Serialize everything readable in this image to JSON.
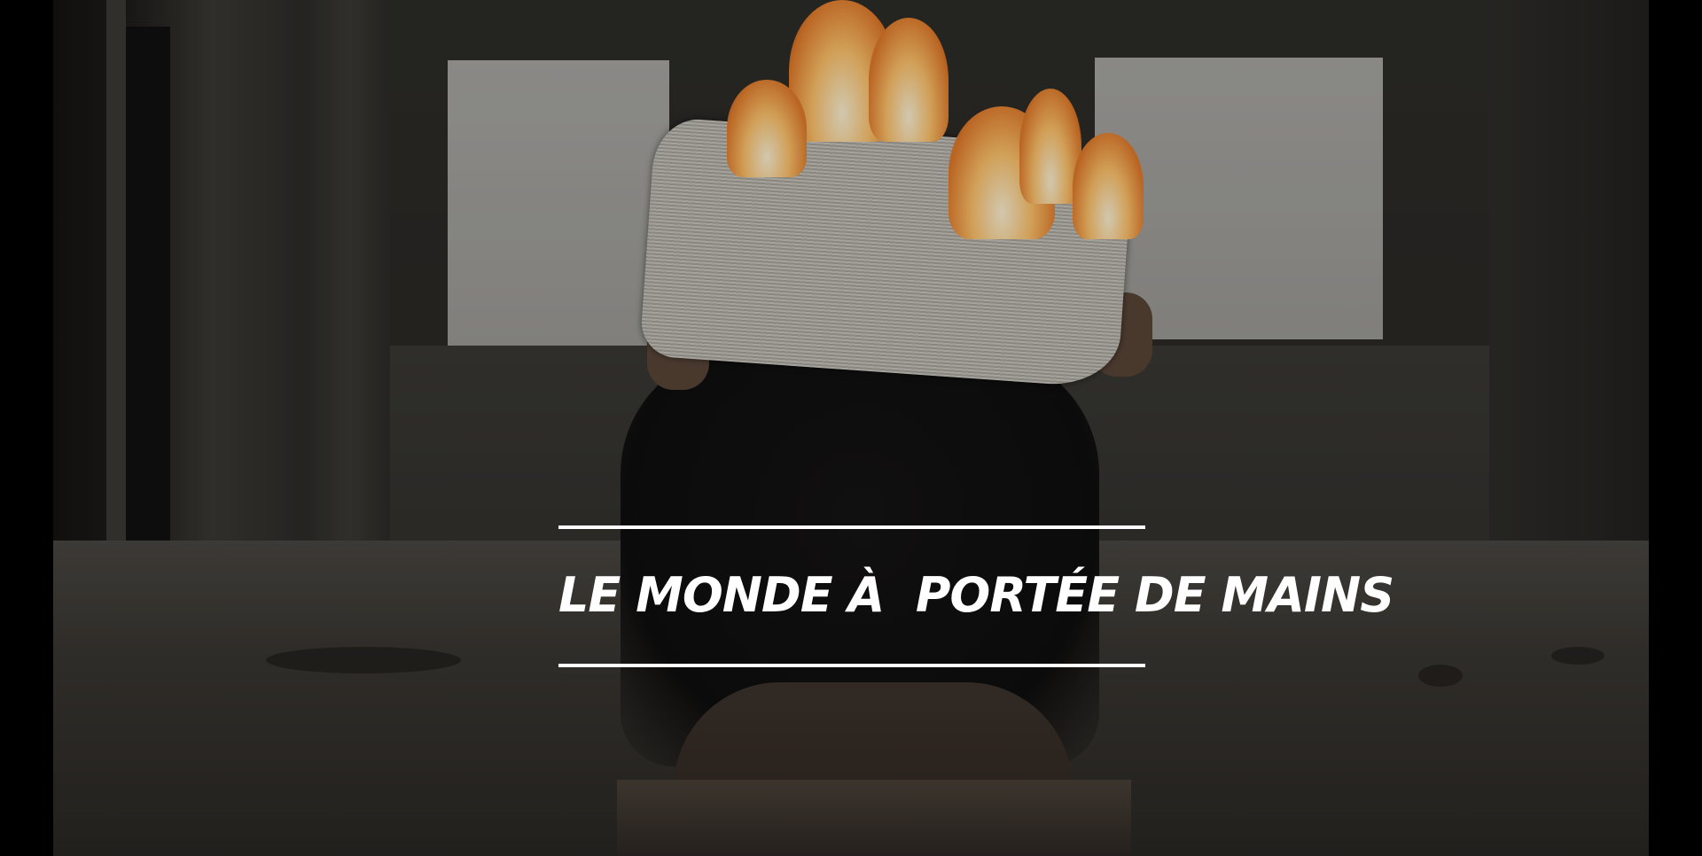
{
  "slide": {
    "title": "LE MONDE À  PORTÉE DE MAINS",
    "title_color": "#ffffff",
    "rule_color": "#ffffff",
    "background_color": "#000000"
  },
  "image": {
    "icon": "burning-newspaper-photo"
  }
}
